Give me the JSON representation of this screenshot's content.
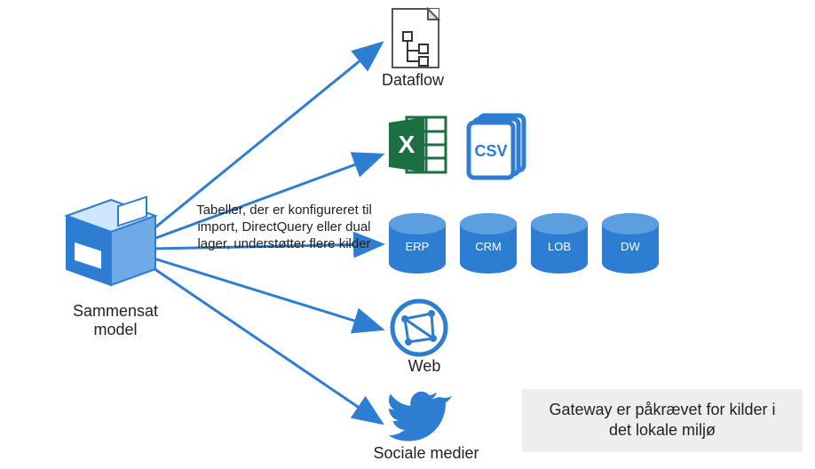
{
  "source": {
    "label": "Sammensat model"
  },
  "targets": {
    "dataflow": "Dataflow",
    "web": "Web",
    "social": "Sociale medier"
  },
  "db": {
    "erp": "ERP",
    "crm": "CRM",
    "lob": "LOB",
    "dw": "DW"
  },
  "csv": "CSV",
  "annotation": "Tabeller, der er konfigureret til import, DirectQuery eller dual lager, understøtter flere kilder",
  "note": "Gateway er påkrævet for kilder i det lokale miljø"
}
